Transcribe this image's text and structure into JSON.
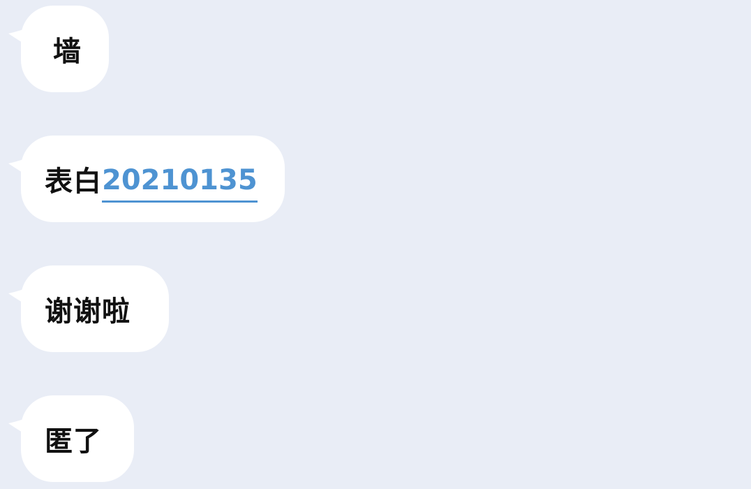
{
  "chat": {
    "messages": [
      {
        "text": "墙",
        "link": ""
      },
      {
        "text": "表白",
        "link": "20210135"
      },
      {
        "text": "谢谢啦",
        "link": ""
      },
      {
        "text": "匿了",
        "link": ""
      }
    ]
  },
  "colors": {
    "background": "#e9edf6",
    "bubble": "#ffffff",
    "text": "#111111",
    "link": "#4e93d2"
  }
}
